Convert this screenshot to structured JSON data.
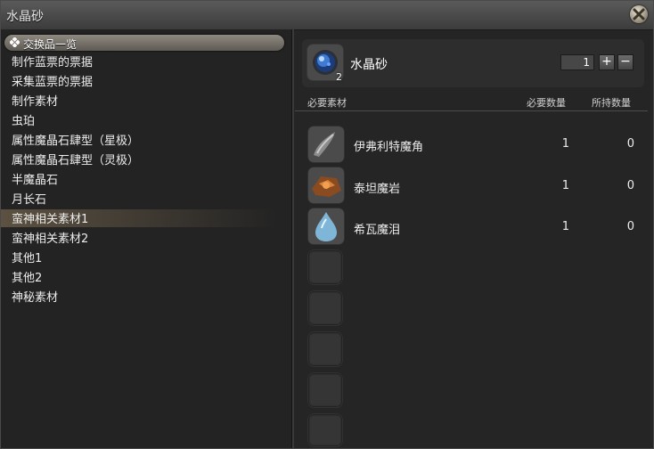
{
  "window": {
    "title": "水晶砂"
  },
  "left": {
    "header": "交换品一览",
    "categories": [
      "制作蓝票的票据",
      "采集蓝票的票据",
      "制作素材",
      "虫珀",
      "属性魔晶石肆型（星极）",
      "属性魔晶石肆型（灵极）",
      "半魔晶石",
      "月长石",
      "蛮神相关素材1",
      "蛮神相关素材2",
      "其他1",
      "其他2",
      "神秘素材"
    ],
    "selected_index": 8
  },
  "item": {
    "name": "水晶砂",
    "icon": "crystal-sand-icon",
    "yield": "2",
    "quantity": "1",
    "plus_label": "+",
    "minus_label": "−"
  },
  "columns": {
    "material": "必要素材",
    "required": "必要数量",
    "owned": "所持数量"
  },
  "materials": [
    {
      "name": "伊弗利特魔角",
      "icon": "ifrit-horn-icon",
      "required": "1",
      "owned": "0"
    },
    {
      "name": "泰坦魔岩",
      "icon": "titan-rock-icon",
      "required": "1",
      "owned": "0"
    },
    {
      "name": "希瓦魔泪",
      "icon": "shiva-tear-icon",
      "required": "1",
      "owned": "0"
    }
  ],
  "colors": {
    "accent": "#8f8a80",
    "background": "#232323"
  }
}
